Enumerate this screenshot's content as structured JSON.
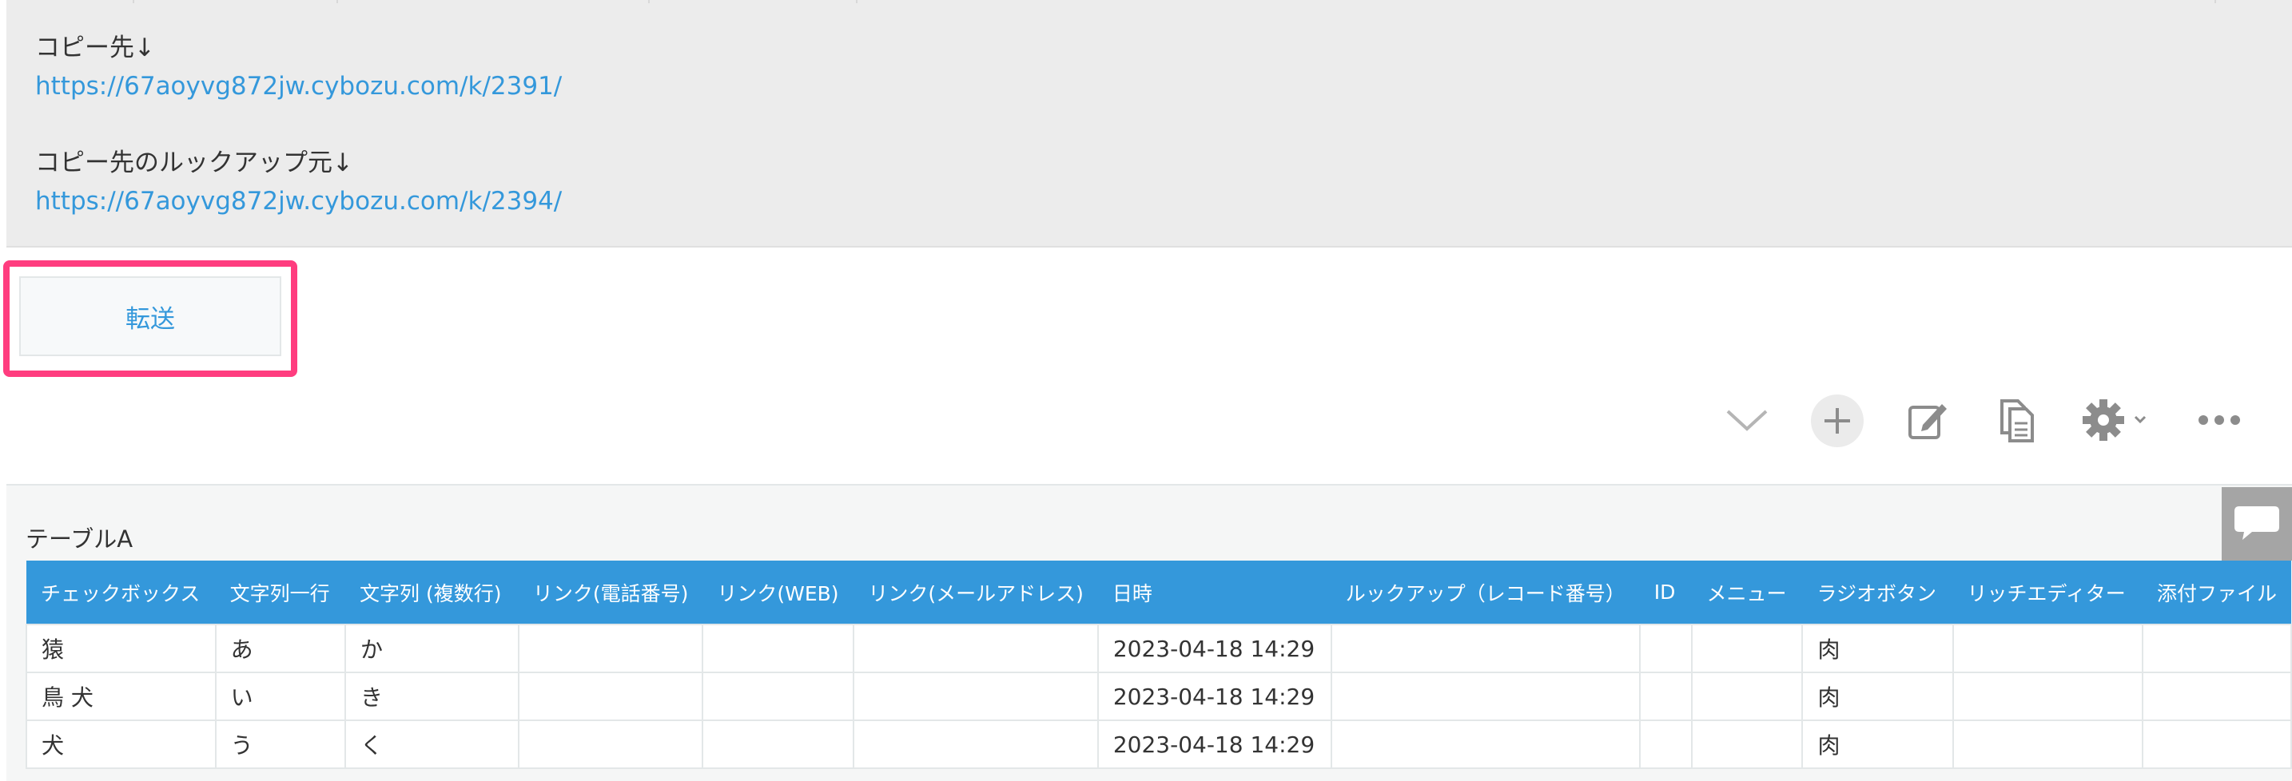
{
  "notes": {
    "copy_dest_label": "コピー先↓",
    "copy_dest_url": "https://67aoyvg872jw.cybozu.com/k/2391/",
    "lookup_src_label": "コピー先のルックアップ元↓",
    "lookup_src_url": "https://67aoyvg872jw.cybozu.com/k/2394/"
  },
  "transfer_button": {
    "label": "転送"
  },
  "toolbar": {
    "icons": [
      "chevron-down-icon",
      "add-icon",
      "edit-icon",
      "duplicate-icon",
      "settings-icon",
      "more-icon"
    ]
  },
  "table": {
    "title": "テーブルA",
    "headers": [
      "チェックボックス",
      "文字列一行",
      "文字列 (複数行)",
      "リンク(電話番号)",
      "リンク(WEB)",
      "リンク(メールアドレス)",
      "日時",
      "ルックアップ（レコード番号）",
      "ID",
      "メニュー",
      "ラジオボタン",
      "リッチエディター",
      "添付ファイル"
    ],
    "rows": [
      [
        "猿",
        "あ",
        "か",
        "",
        "",
        "",
        "2023-04-18 14:29",
        "",
        "",
        "",
        "肉",
        "",
        ""
      ],
      [
        "鳥 犬",
        "い",
        "き",
        "",
        "",
        "",
        "2023-04-18 14:29",
        "",
        "",
        "",
        "肉",
        "",
        ""
      ],
      [
        "犬",
        "う",
        "く",
        "",
        "",
        "",
        "2023-04-18 14:29",
        "",
        "",
        "",
        "肉",
        "",
        ""
      ]
    ]
  },
  "colors": {
    "accent": "#3498db",
    "highlight": "#ff3d7f",
    "panel_bg": "#ececec"
  }
}
